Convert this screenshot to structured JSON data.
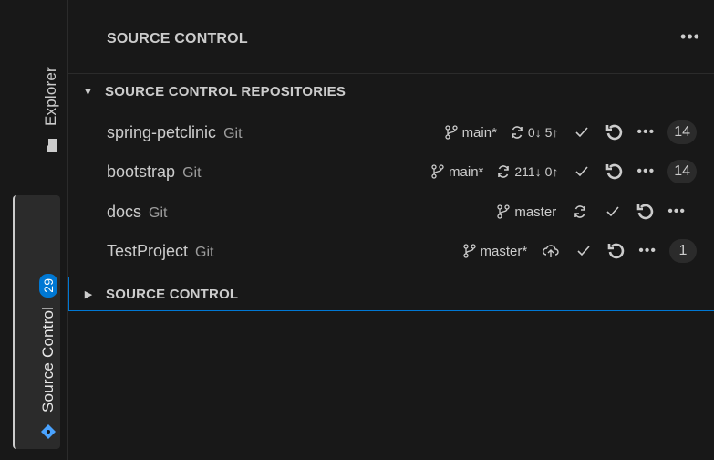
{
  "activity_bar": {
    "explorer_label": "Explorer",
    "scm_label": "Source Control",
    "scm_badge": "29"
  },
  "panel": {
    "title": "SOURCE CONTROL",
    "more_label": "•••"
  },
  "sections": {
    "repositories_title": "SOURCE CONTROL REPOSITORIES",
    "source_control_title": "SOURCE CONTROL"
  },
  "repositories": [
    {
      "name": "spring-petclinic",
      "provider": "Git",
      "branch": "main*",
      "sync": "0↓ 5↑",
      "count": "14"
    },
    {
      "name": "bootstrap",
      "provider": "Git",
      "branch": "main*",
      "sync": "211↓ 0↑",
      "count": "14"
    },
    {
      "name": "docs",
      "provider": "Git",
      "branch": "master",
      "sync": "",
      "count": ""
    },
    {
      "name": "TestProject",
      "provider": "Git",
      "branch": "master*",
      "sync": "",
      "count": "1"
    }
  ],
  "icons": {
    "branch": "git-branch-icon",
    "sync": "sync-icon",
    "publish": "cloud-upload-icon",
    "commit": "check-icon",
    "refresh": "refresh-icon",
    "more": "more-icon"
  },
  "colors": {
    "background": "#181818",
    "accent": "#0078d4",
    "text": "#cccccc",
    "muted": "#9d9d9d"
  }
}
